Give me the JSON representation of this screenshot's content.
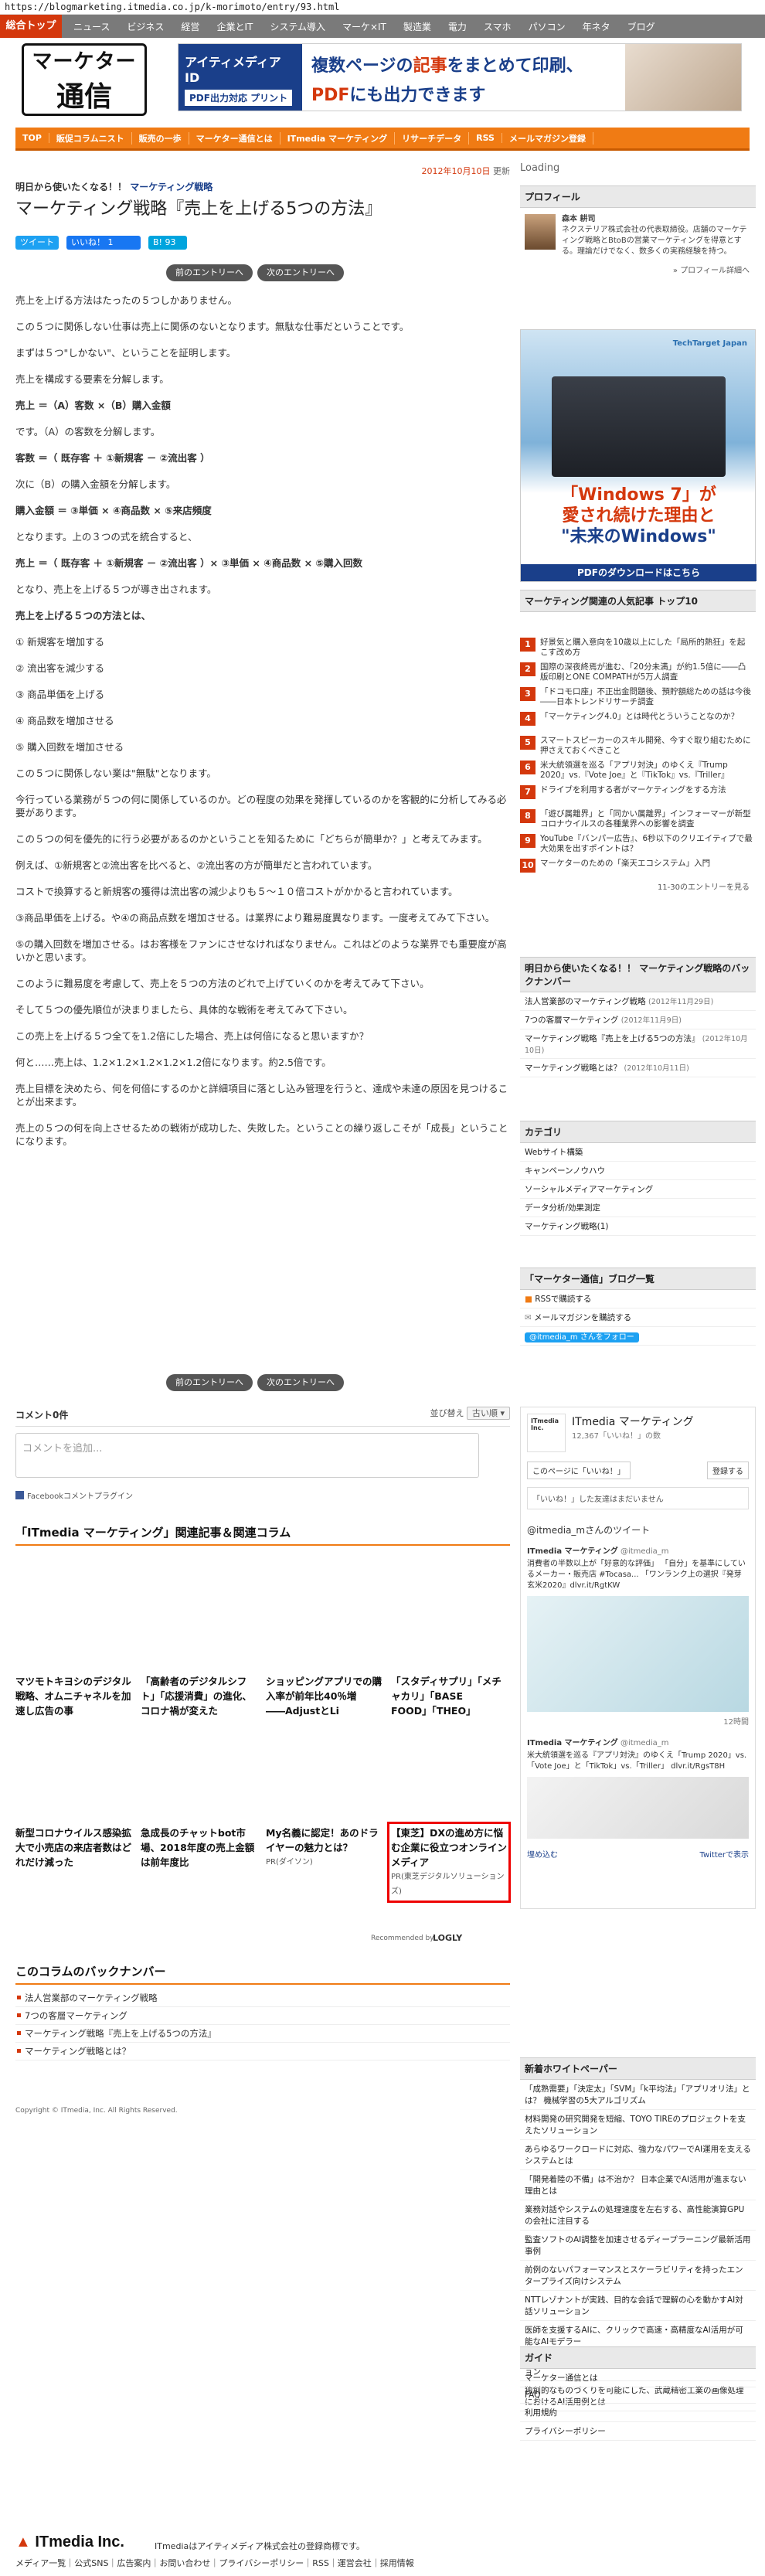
{
  "browser": {
    "url": "https://blogmarketing.itmedia.co.jp/k-morimoto/entry/93.html"
  },
  "topnav": {
    "home": "総合トップ",
    "items": [
      "ニュース",
      "ビジネス",
      "経営",
      "企業とIT",
      "システム導入",
      "マーケ×IT",
      "製造業",
      "電力",
      "スマホ",
      "パソコン",
      "年ネタ",
      "ブログ"
    ]
  },
  "header": {
    "logo_line1": "マーケター",
    "logo_line2": "通信",
    "banner_left_title": "アイティメディアID",
    "banner_left_sub": "PDF出力対応 プリント",
    "banner_line1_pre": "複数ページの",
    "banner_line1_em": "記事",
    "banner_line1_post": "をまとめて印刷、",
    "banner_line2_em": "PDF",
    "banner_line2_post": "にも出力できます"
  },
  "orangenav": [
    "TOP",
    "販促コラムニスト",
    "販売の一歩",
    "マーケター通信とは",
    "ITmedia マーケティング",
    "リサーチデータ",
    "RSS",
    "メールマガジン登録"
  ],
  "article": {
    "date_prefix": "2012年10月10日",
    "date_suffix": "更新",
    "breadcrumb_pre": "明日から使いたくなる！！",
    "breadcrumb_link": "マーケティング戦略",
    "title": "マーケティング戦略『売上を上げる5つの方法』",
    "social": {
      "tweet": "ツイート",
      "like": "いいね！ 1",
      "hatena": "B! 93"
    },
    "prev": "前のエントリーへ",
    "next": "次のエントリーへ",
    "paragraphs": [
      {
        "t": "売上を上げる方法はたったの５つしかありません。",
        "b": false
      },
      {
        "t": "この５つに関係しない仕事は売上に関係のないとなります。無駄な仕事だということです。",
        "b": false
      },
      {
        "t": "まずは５つ\"しかない\"、ということを証明します。",
        "b": false
      },
      {
        "t": "売上を構成する要素を分解します。",
        "b": false
      },
      {
        "t": "売上 ＝（A）客数 ×（B）購入金額",
        "b": true
      },
      {
        "t": "です。（A）の客数を分解します。",
        "b": false
      },
      {
        "t": "客数 ＝（ 既存客 ＋ ①新規客 － ②流出客 ）",
        "b": true
      },
      {
        "t": "次に（B）の購入金額を分解します。",
        "b": false
      },
      {
        "t": "購入金額 ＝ ③単価 × ④商品数 × ⑤来店頻度",
        "b": true
      },
      {
        "t": "となります。上の３つの式を統合すると、",
        "b": false
      },
      {
        "t": "売上 ＝（ 既存客 ＋ ①新規客 － ②流出客 ）× ③単価 × ④商品数 × ⑤購入回数",
        "b": true
      },
      {
        "t": "となり、売上を上げる５つが導き出されます。",
        "b": false
      },
      {
        "t": "売上を上げる５つの方法とは、",
        "b": true
      },
      {
        "t": "① 新規客を増加する",
        "b": false
      },
      {
        "t": "② 流出客を減少する",
        "b": false
      },
      {
        "t": "③ 商品単価を上げる",
        "b": false
      },
      {
        "t": "④ 商品数を増加させる",
        "b": false
      },
      {
        "t": "⑤ 購入回数を増加させる",
        "b": false
      },
      {
        "t": "この５つに関係しない業は\"無駄\"となります。",
        "b": false
      },
      {
        "t": "今行っている業務が５つの何に関係しているのか。どの程度の効果を発揮しているのかを客観的に分析してみる必要があります。",
        "b": false
      },
      {
        "t": "この５つの何を優先的に行う必要があるのかということを知るために「どちらが簡単か？」と考えてみます。",
        "b": false
      },
      {
        "t": "例えば、①新規客と②流出客を比べると、②流出客の方が簡単だと言われています。",
        "b": false
      },
      {
        "t": "コストで換算すると新規客の獲得は流出客の減少よりも５～１０倍コストがかかると言われています。",
        "b": false
      },
      {
        "t": "③商品単価を上げる。や④の商品点数を増加させる。は業界により難易度異なります。一度考えてみて下さい。",
        "b": false
      },
      {
        "t": "⑤の購入回数を増加させる。はお客様をファンにさせなければなりません。これはどのような業界でも重要度が高いかと思います。",
        "b": false
      },
      {
        "t": "このように難易度を考慮して、売上を５つの方法のどれで上げていくのかを考えてみて下さい。",
        "b": false
      },
      {
        "t": "そして５つの優先順位が決まりましたら、具体的な戦術を考えてみて下さい。",
        "b": false
      },
      {
        "t": "この売上を上げる５つ全てを1.2倍にした場合、売上は何倍になると思いますか？",
        "b": false
      },
      {
        "t": "何と……売上は、1.2×1.2×1.2×1.2×1.2倍になります。約2.5倍です。",
        "b": false
      },
      {
        "t": "売上目標を決めたら、何を何倍にするのかと詳細項目に落とし込み管理を行うと、達成や未達の原因を見つけることが出来ます。",
        "b": false
      },
      {
        "t": "売上の５つの何を向上させるための戦術が成功した、失敗した。ということの繰り返しこそが「成長」ということになります。",
        "b": false
      }
    ]
  },
  "comments": {
    "count": "コメント0件",
    "sort_label": "並び替え",
    "sort_value": "古い順 ▾",
    "placeholder": "コメントを追加...",
    "plugin": "Facebookコメントプラグイン"
  },
  "related": {
    "title": "「ITmedia マーケティング」関連記事＆関連コラム",
    "row1": [
      {
        "t": "マツモトキヨシのデジタル戦略、オムニチャネルを加速し広告の事"
      },
      {
        "t": "「高齢者のデジタルシフト」「応援消費」の進化、コロナ禍が変えた"
      },
      {
        "t": "ショッピングアプリでの購入率が前年比40％増――AdjustとLi"
      },
      {
        "t": "「スタディサプリ」「メチャカリ」「BASE FOOD」「THEO」"
      }
    ],
    "row2": [
      {
        "t": "新型コロナウイルス感染拡大で小売店の来店者数はどれだけ減った",
        "s": ""
      },
      {
        "t": "急成長のチャットbot市場、2018年度の売上金額は前年度比",
        "s": ""
      },
      {
        "t": "My名義に認定！あのドライヤーの魅力とは？",
        "s": "PR(ダイソン)"
      },
      {
        "t": "【東芝】DXの進め方に悩む企業に役立つオンラインメディア",
        "s": "PR(東芝デジタルソリューションズ)"
      }
    ],
    "recommended": "Recommended by",
    "logly": "LOGLY"
  },
  "backnumber": {
    "title": "このコラムのバックナンバー",
    "items": [
      "法人営業部のマーケティング戦略",
      "7つの客層マーケティング",
      "マーケティング戦略『売上を上げる5つの方法』",
      "マーケティング戦略とは？"
    ]
  },
  "copyright": "Copyright © ITmedia, Inc. All Rights Reserved.",
  "sidebar": {
    "loading": "Loading",
    "profile_title": "プロフィール",
    "profile_name": "森本 耕司",
    "profile_text": "ネクステリア株式会社の代表取締役。店舗のマーケティング戦略とBtoBの営業マーケティングを得意とする。理論だけでなく、数多くの実務経験を持つ。",
    "profile_link": "» プロフィール詳細へ",
    "ad_brand": "TechTarget Japan",
    "ad_title1": "「Windows 7」が",
    "ad_title2": "愛され続けた理由と",
    "ad_title3": "\"未来のWindows\"",
    "ad_cta": "PDFのダウンロードはこちら",
    "ranking_title": "マーケティング関連の人気記事 トップ10",
    "ranking": [
      "好景気と購入意向を10歳以上にした「局所的熱狂」を起こす改め方",
      "国際の深夜終焉が進む、「20分未満」が約1.5倍に――凸版印刷とONE COMPATHが5万人調査",
      "「ドコモ口座」不正出金問題後、預貯額総ための話は今後――日本トレンドリサーチ調査",
      "「マーケティング4.0」とは時代とういうことなのか？",
      "スマートスピーカーのスキル開発、今すぐ取り組むために押さえておくべきこと",
      "米大統領選を巡る「アプリ対決」のゆくえ『Trump 2020』vs.『Vote Joe』と『TikTok』vs.『Triller』",
      "ドライブを利用する者がマーケティングをする方法",
      "「遊び属離界」と「同かい属離界」インフォーマーが新型コロナウイルスの各種業界への影響を調査",
      "YouTube『バンパー広告』、6秒以下のクリエイティブで最大効果を出すポイントは？",
      "マーケターのための「楽天エコシステム」入門"
    ],
    "ranking_period": "11-30のエントリーを見る",
    "back_title": "明日から使いたくなる！！ マーケティング戦略のバックナンバー",
    "back_items": [
      {
        "t": "法人営業部のマーケティング戦略",
        "d": "(2012年11月29日)"
      },
      {
        "t": "7つの客層マーケティング",
        "d": "(2012年11月9日)"
      },
      {
        "t": "マーケティング戦略『売上を上げる5つの方法』",
        "d": "(2012年10月10日)"
      },
      {
        "t": "マーケティング戦略とは？",
        "d": "(2012年10月11日)"
      }
    ],
    "category_title": "カテゴリ",
    "categories": [
      "Webサイト構築",
      "キャンペーンノウハウ",
      "ソーシャルメディアマーケティング",
      "データ分析/効果測定",
      "マーケティング戦略(1)"
    ],
    "blog_title": "「マーケター通信」ブログ一覧",
    "rss": "RSSで購読する",
    "mail": "メールマガジンを購読する",
    "twitter_follow": "@itmedia_m さんをフォロー",
    "fb_name": "ITmedia マーケティング",
    "fb_likes": "12,367「いいね！」の数",
    "fb_like_btn": "このページに「いいね！」",
    "fb_register": "登録する",
    "fb_first": "「いいね！」した友達はまだいません",
    "tw_header": "@itmedia_mさんのツイート",
    "tw_user": "ITmedia マーケティング",
    "tw_handle": "@itmedia_m",
    "tw_text1": "消費者の半数以上が「好意的な評価」 「自分」を基準にしているメーカー・販売店 #Tocasa... 「ワンランク上の選択『発芽玄米2020』dlvr.it/RgtKW",
    "tw_text2": "米大統領選を巡る『アプリ対決』のゆくえ「Trump 2020」vs.「Vote Joe」と「TikTok」vs.「Triller」 dlvr.it/RgsT8H",
    "tw_time": "12時間",
    "tw_embed": "埋め込む",
    "tw_view": "Twitterで表示",
    "wp_title": "新着ホワイトペーパー",
    "whitepapers": [
      "「成熟需要」「決定太」「SVM」「k平均法」「アプリオリ法」とは？ 機械学習の5大アルゴリズム",
      "材料開発の研究開発を短縮、TOYO TIREのプロジェクトを支えたソリューション",
      "あらゆるワークロードに対応、強力なパワーでAI運用を支えるシステムとは",
      "「開発着陸の不備」は不治か？ 日本企業でAI活用が進まない理由とは",
      "業務対話やシステムの処理速度を左右する、高性能演算GPUの会社に注目する",
      "監査ソフトのAI調整を加速させるディープラーニング最新活用事例",
      "前例のないパフォーマンスとスケーラビリティを持ったエンタープライズ向けシステム",
      "NTTレゾナントが実践、目的な会話で理解の心を動かすAI対話ソリューション",
      "医師を支援するAIに、クリックで高速・高精度なAI活用が可能なAIモデラー",
      "デスクサイドに設置可能な、水冷式AI開発用ワークステーション",
      "独創的なものづくりを可能にした、武蔵精密工業の画像処理におけるAI活用例とは"
    ],
    "guide_title": "ガイド",
    "guide": [
      "マーケター通信とは",
      "FAQ",
      "利用規約",
      "プライバシーポリシー"
    ]
  },
  "footer": {
    "logo": "ITmedia Inc.",
    "corp": "ITmediaはアイティメディア株式会社の登録商標です。",
    "links": "メディア一覧｜公式SNS｜広告案内｜お問い合わせ｜プライバシーポリシー｜RSS｜運営会社｜採用情報"
  }
}
